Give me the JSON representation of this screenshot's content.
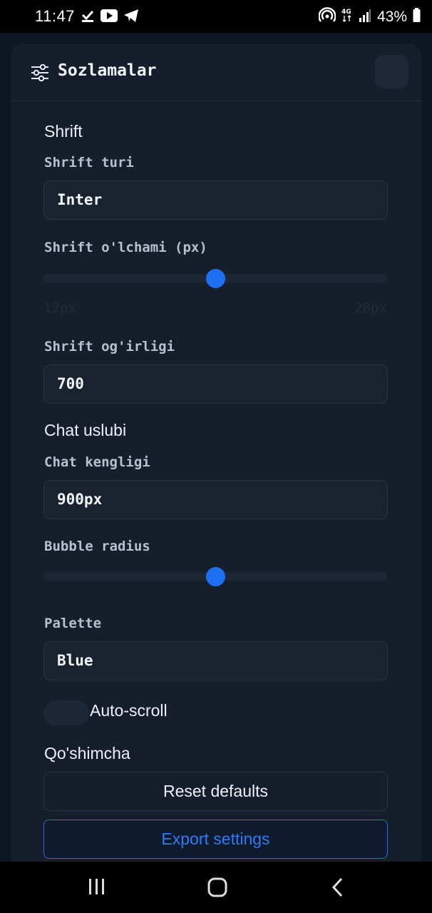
{
  "status_bar": {
    "time": "11:47",
    "battery": "43%",
    "left_icons": [
      "check-download-icon",
      "youtube-icon",
      "telegram-icon"
    ],
    "right_icons": [
      "hotspot-icon",
      "4g-icon",
      "signal-icon",
      "battery-icon"
    ]
  },
  "header": {
    "title": "Sozlamalar",
    "icon": "sliders-icon"
  },
  "sections": {
    "font": {
      "title": "Shrift",
      "type_label": "Shrift turi",
      "type_value": "Inter",
      "size_label": "Shrift o'lchami (px)",
      "size_min": "12px",
      "size_max": "28px",
      "size_fraction": 0.5,
      "weight_label": "Shrift og'irligi",
      "weight_value": "700"
    },
    "chat": {
      "title": "Chat uslubi",
      "width_label": "Chat kengligi",
      "width_value": "900px",
      "radius_label": "Bubble radius",
      "radius_fraction": 0.5,
      "palette_label": "Palette",
      "palette_value": "Blue",
      "autoscroll_label": "Auto-scroll",
      "autoscroll_on": false
    },
    "extra": {
      "title": "Qo'shimcha",
      "reset_label": "Reset defaults",
      "export_label": "Export settings"
    }
  },
  "colors": {
    "accent": "#1f6ff2",
    "background": "#0f1623",
    "panel": "#161e2c"
  },
  "nav_bar": {
    "icons": [
      "recent-apps-icon",
      "home-icon",
      "back-icon"
    ]
  }
}
